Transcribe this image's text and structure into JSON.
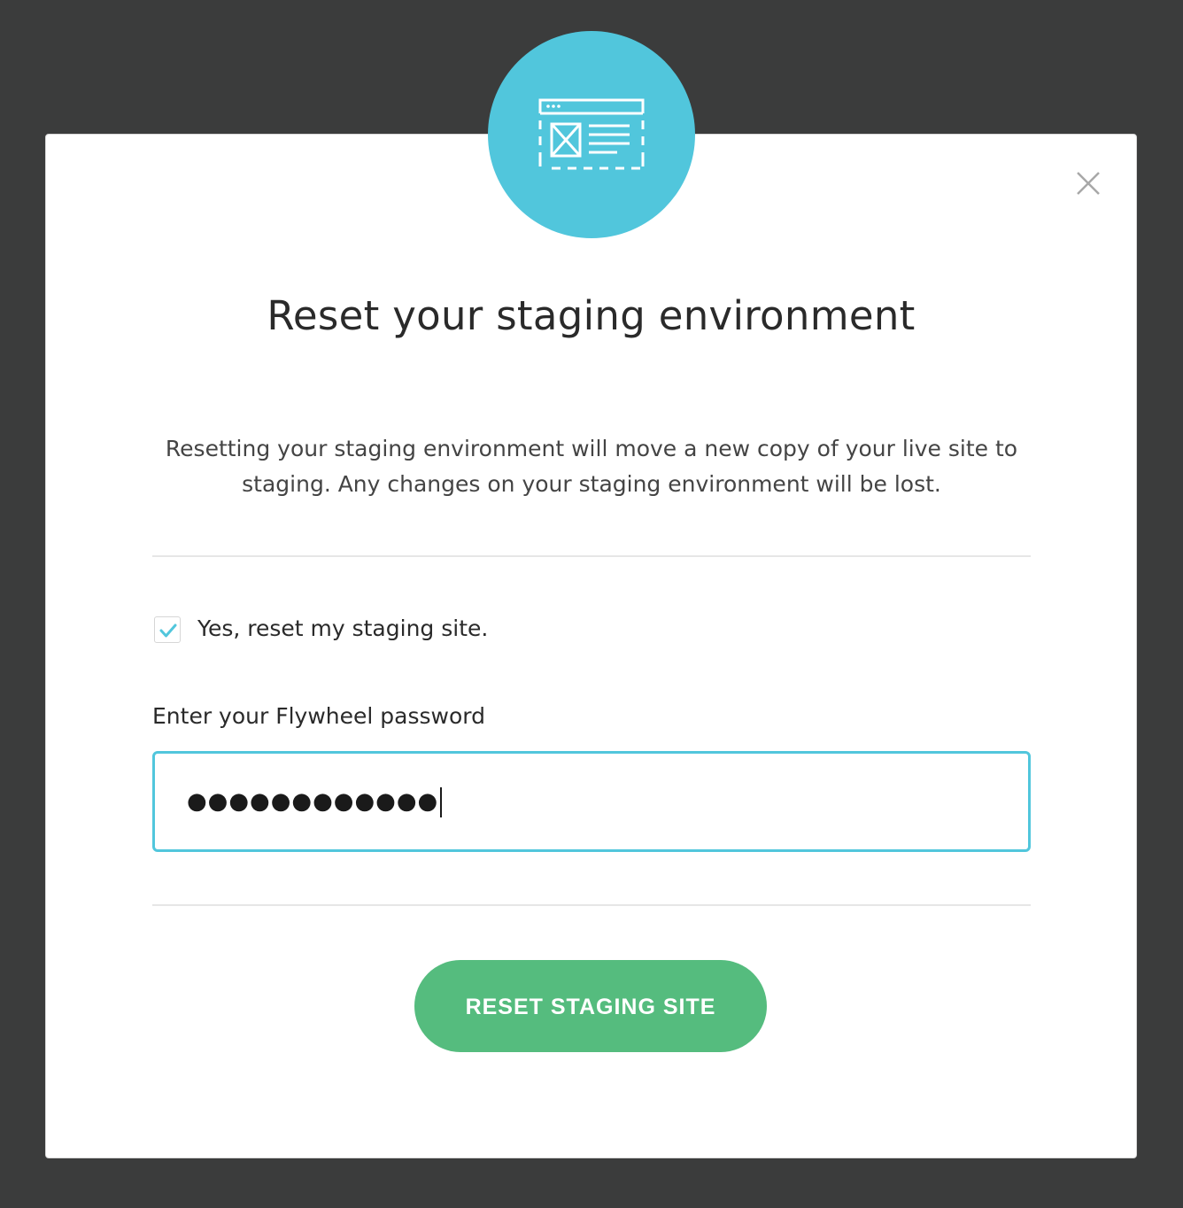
{
  "modal": {
    "title": "Reset your staging environment",
    "description": "Resetting your staging environment will move a new copy of your live site to staging. Any changes on your staging environment will be lost.",
    "confirm_checkbox": {
      "label": "Yes, reset my staging site.",
      "checked": true
    },
    "password_field": {
      "label": "Enter your Flywheel password",
      "masked_value": "●●●●●●●●●●●●"
    },
    "submit_label": "RESET STAGING SITE",
    "icons": {
      "header": "staging-site-layout-icon",
      "close": "close-icon",
      "check": "checkmark-icon"
    }
  },
  "colors": {
    "overlay": "#3b3c3c",
    "accent": "#51c6dc",
    "primary_button": "#55bc7e"
  }
}
